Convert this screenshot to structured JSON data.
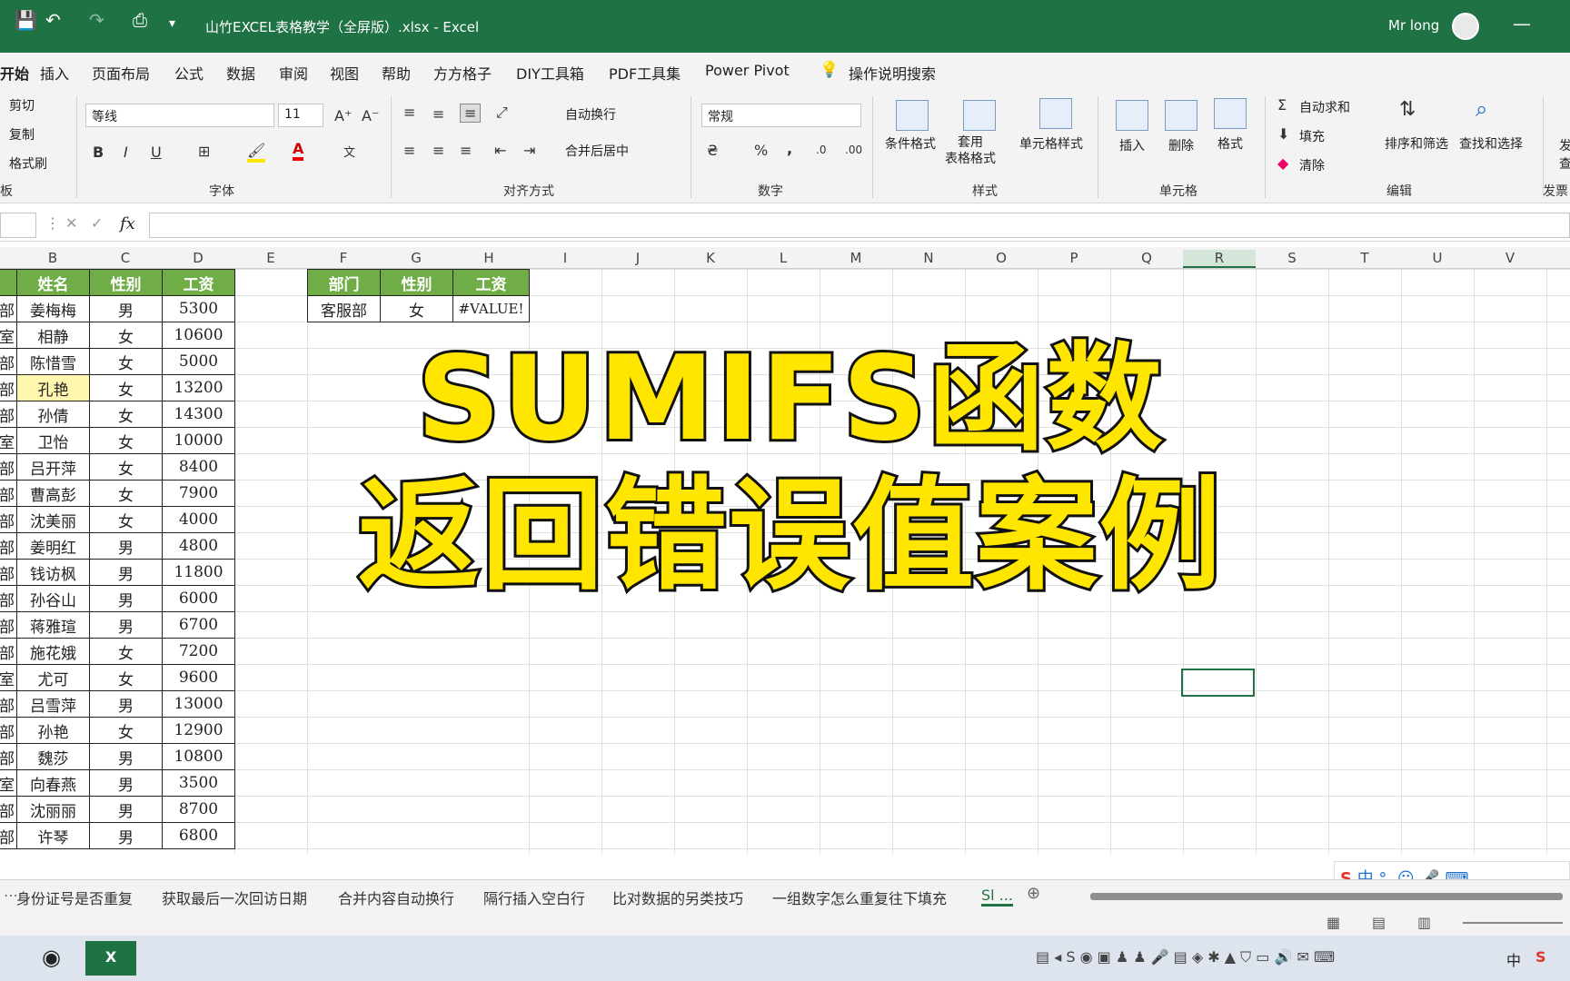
{
  "titlebar": {
    "doc_title": "山竹EXCEL表格教学（全屏版）.xlsx  -  Excel",
    "user": "Mr long"
  },
  "menu": [
    "开始",
    "插入",
    "页面布局",
    "公式",
    "数据",
    "审阅",
    "视图",
    "帮助",
    "方方格子",
    "DIY工具箱",
    "PDF工具集",
    "Power Pivot",
    "操作说明搜索"
  ],
  "ribbon": {
    "clipboard": {
      "cut": "剪切",
      "copy": "复制",
      "painter": "格式刷",
      "label": "板"
    },
    "font": {
      "name": "等线",
      "size": "11",
      "label": "字体",
      "bold": "B",
      "italic": "I",
      "underline": "U"
    },
    "align": {
      "wrap": "自动换行",
      "merge": "合并后居中",
      "label": "对齐方式"
    },
    "number": {
      "format": "常规",
      "label": "数字",
      "percent": "%",
      "comma": ","
    },
    "styles": {
      "cond": "条件格式",
      "table": "套用\n表格格式",
      "cell": "单元格样式",
      "label": "样式"
    },
    "cells": {
      "insert": "插入",
      "delete": "删除",
      "format": "格式",
      "label": "单元格"
    },
    "editing": {
      "autosum": "自动求和",
      "fill": "填充",
      "clear": "清除",
      "sort": "排序和筛选",
      "find": "查找和选择",
      "label": "编辑"
    },
    "extra": {
      "top": "发",
      "bottom": "查",
      "label": "发票"
    }
  },
  "formula_bar": {
    "fx": "fx",
    "value": ""
  },
  "columns": [
    "B",
    "C",
    "D",
    "E",
    "F",
    "G",
    "H",
    "I",
    "J",
    "K",
    "L",
    "M",
    "N",
    "O",
    "P",
    "Q",
    "R",
    "S",
    "T",
    "U",
    "V"
  ],
  "main_table": {
    "headers": [
      "姓名",
      "性别",
      "工资"
    ],
    "rows": [
      [
        "部",
        "姜梅梅",
        "男",
        "5300"
      ],
      [
        "室",
        "相静",
        "女",
        "10600"
      ],
      [
        "部",
        "陈惜雪",
        "女",
        "5000"
      ],
      [
        "部",
        "孔艳",
        "女",
        "13200"
      ],
      [
        "部",
        "孙倩",
        "女",
        "14300"
      ],
      [
        "室",
        "卫怡",
        "女",
        "10000"
      ],
      [
        "部",
        "吕开萍",
        "女",
        "8400"
      ],
      [
        "部",
        "曹高彭",
        "女",
        "7900"
      ],
      [
        "部",
        "沈美丽",
        "女",
        "4000"
      ],
      [
        "部",
        "姜明红",
        "男",
        "4800"
      ],
      [
        "部",
        "钱访枫",
        "男",
        "11800"
      ],
      [
        "部",
        "孙谷山",
        "男",
        "6000"
      ],
      [
        "部",
        "蒋雅瑄",
        "男",
        "6700"
      ],
      [
        "部",
        "施花娥",
        "女",
        "7200"
      ],
      [
        "室",
        "尤可",
        "女",
        "9600"
      ],
      [
        "部",
        "吕雪萍",
        "男",
        "13000"
      ],
      [
        "部",
        "孙艳",
        "女",
        "12900"
      ],
      [
        "部",
        "魏莎",
        "男",
        "10800"
      ],
      [
        "室",
        "向春燕",
        "男",
        "3500"
      ],
      [
        "部",
        "沈丽丽",
        "男",
        "8700"
      ],
      [
        "部",
        "许琴",
        "男",
        "6800"
      ]
    ]
  },
  "criteria_table": {
    "headers": [
      "部门",
      "性别",
      "工资"
    ],
    "row": [
      "客服部",
      "女",
      "#VALUE!"
    ]
  },
  "overlay": {
    "line1": "SUMIFS函数",
    "line2": "返回错误值案例"
  },
  "sheet_tabs": [
    "身份证号是否重复",
    "获取最后一次回访日期",
    "合并内容自动换行",
    "隔行插入空白行",
    "比对数据的另类技巧",
    "一组数字怎么重复往下填充",
    "Sl ..."
  ],
  "ime": "中 °, ☺ 🎤 ⌨",
  "taskbar": {
    "clock": "中"
  },
  "colors": {
    "excel_green": "#1f7244",
    "header_green": "#70ad47",
    "overlay_yellow": "#ffe600"
  }
}
